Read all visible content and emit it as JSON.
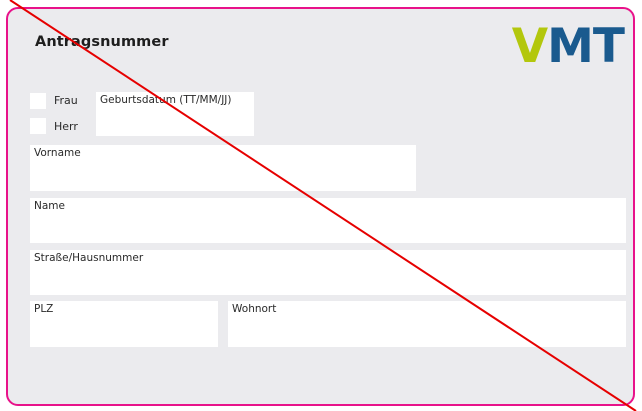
{
  "form": {
    "title": "Antragsnummer",
    "logo": {
      "v": "V",
      "mt": "MT"
    },
    "salutation": {
      "frau": "Frau",
      "herr": "Herr"
    },
    "fields": {
      "birthdate_label": "Geburtsdatum (TT/MM/JJ)",
      "firstname_label": "Vorname",
      "name_label": "Name",
      "street_label": "Straße/Hausnummer",
      "zip_label": "PLZ",
      "city_label": "Wohnort"
    }
  },
  "colors": {
    "border": "#e8128a",
    "background": "#ebebee",
    "logo_green": "#b3c70d",
    "logo_blue": "#1a5a8e",
    "strike": "#e60000"
  }
}
